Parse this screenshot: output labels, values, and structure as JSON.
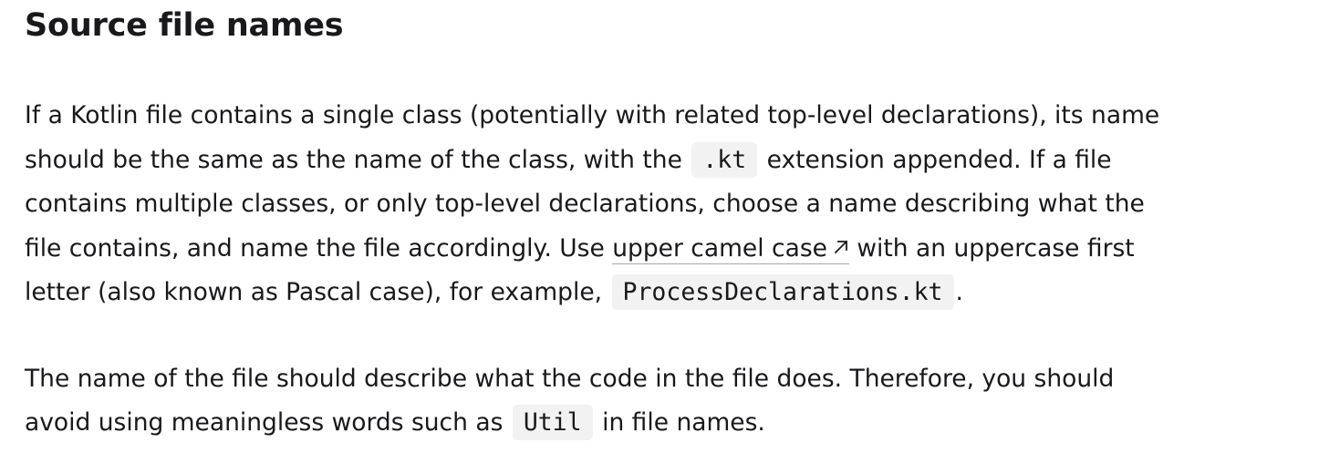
{
  "section": {
    "title": "Source file names"
  },
  "paragraph1": {
    "line1": "If a Kotlin file contains a single class (potentially with related top-level declarations), its name",
    "line2_a": "should be the same as the name of the class, with the",
    "code_ext": ".kt",
    "line2_b": "extension appended. If a file",
    "line3": "contains multiple classes, or only top-level declarations, choose a name describing what the",
    "line4_a": "file contains, and name the file accordingly. Use",
    "link_text": "upper camel case",
    "link_icon": "external-link-arrow-icon",
    "line4_b": "with an uppercase first",
    "line5_a": "letter (also known as Pascal case), for example,",
    "code_example": "ProcessDeclarations.kt",
    "line5_b": "."
  },
  "paragraph2": {
    "line1": "The name of the file should describe what the code in the file does. Therefore, you should",
    "line2_a": "avoid using meaningless words such as",
    "code_util": "Util",
    "line2_b": "in file names."
  }
}
